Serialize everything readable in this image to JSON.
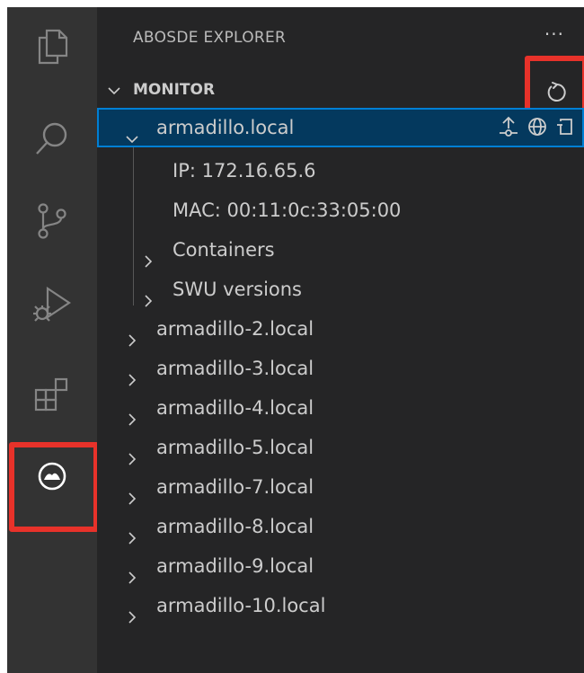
{
  "view_title": "ABOSDE EXPLORER",
  "more_label": "···",
  "section": {
    "label": "MONITOR"
  },
  "tree": {
    "selected_device": {
      "label": "armadillo.local",
      "details": [
        "IP: 172.16.65.6",
        "MAC: 00:11:0c:33:05:00"
      ],
      "groups": [
        "Containers",
        "SWU versions"
      ]
    },
    "devices": [
      "armadillo-2.local",
      "armadillo-3.local",
      "armadillo-4.local",
      "armadillo-5.local",
      "armadillo-7.local",
      "armadillo-8.local",
      "armadillo-9.local",
      "armadillo-10.local"
    ]
  },
  "activity_bar": [
    "explorer-icon",
    "search-icon",
    "source-control-icon",
    "run-debug-icon",
    "extensions-icon",
    "abosde-icon"
  ],
  "colors": {
    "activity_bg": "#333333",
    "sidebar_bg": "#252526",
    "selection_bg": "#04395e",
    "selection_border": "#007fd4",
    "highlight_box": "#e8322a"
  }
}
